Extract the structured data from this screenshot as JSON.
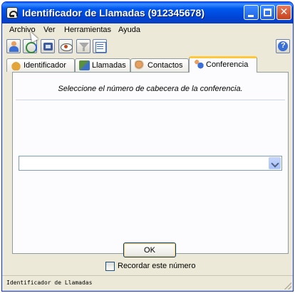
{
  "window": {
    "title": "Identificador de Llamadas (912345678)"
  },
  "menu": {
    "items": [
      "Archivo",
      "Ver",
      "Herramientas",
      "Ayuda"
    ]
  },
  "toolbar": {
    "icons": [
      "user-icon",
      "refresh-icon",
      "phone-icon",
      "eye-icon",
      "filter-icon",
      "list-icon",
      "help-icon"
    ]
  },
  "tabs": [
    {
      "label": "Identificador",
      "icon": "bell-icon"
    },
    {
      "label": "Llamadas",
      "icon": "calls-icon"
    },
    {
      "label": "Contactos",
      "icon": "contacts-icon"
    },
    {
      "label": "Conferencia",
      "icon": "conference-icon",
      "active": true
    }
  ],
  "panel": {
    "instruction": "Seleccione el número de cabecera de la conferencia.",
    "combo_value": ""
  },
  "actions": {
    "ok_label": "OK",
    "remember_label": "Recordar este número",
    "remember_checked": false
  },
  "status": {
    "text": "Identificador de Llamadas"
  },
  "colors": {
    "titlebar": "#0058ee",
    "active_tab_accent": "#ffc83c",
    "window_bg": "#ece9d8"
  }
}
